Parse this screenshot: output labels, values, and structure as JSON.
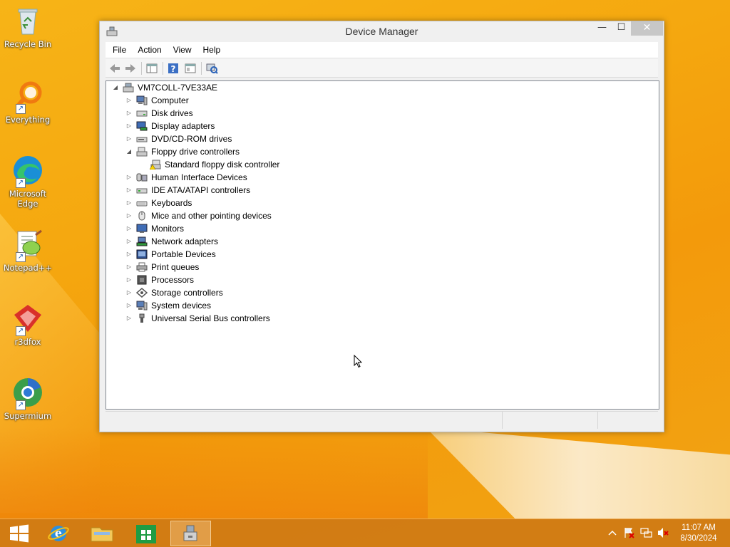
{
  "desktop": {
    "icons": [
      {
        "label": "Recycle Bin"
      },
      {
        "label": "Everything"
      },
      {
        "label": "Microsoft Edge"
      },
      {
        "label": "Notepad++"
      },
      {
        "label": "r3dfox"
      },
      {
        "label": "Supermium"
      }
    ]
  },
  "window": {
    "title": "Device Manager",
    "controls": {
      "minimize": "—",
      "maximize": "☐",
      "close": "✕"
    },
    "menu": [
      "File",
      "Action",
      "View",
      "Help"
    ]
  },
  "tree": {
    "root": "VM7COLL-7VE33AE",
    "categories": [
      {
        "label": "Computer",
        "icon": "computer-icon"
      },
      {
        "label": "Disk drives",
        "icon": "disk-drive-icon"
      },
      {
        "label": "Display adapters",
        "icon": "display-adapter-icon"
      },
      {
        "label": "DVD/CD-ROM drives",
        "icon": "dvd-drive-icon"
      },
      {
        "label": "Floppy drive controllers",
        "icon": "floppy-controller-icon",
        "expanded": true,
        "children": [
          {
            "label": "Standard floppy disk controller",
            "icon": "warning-device-icon"
          }
        ]
      },
      {
        "label": "Human Interface Devices",
        "icon": "hid-icon"
      },
      {
        "label": "IDE ATA/ATAPI controllers",
        "icon": "ide-controller-icon"
      },
      {
        "label": "Keyboards",
        "icon": "keyboard-icon"
      },
      {
        "label": "Mice and other pointing devices",
        "icon": "mouse-icon"
      },
      {
        "label": "Monitors",
        "icon": "monitor-icon"
      },
      {
        "label": "Network adapters",
        "icon": "network-adapter-icon"
      },
      {
        "label": "Portable Devices",
        "icon": "portable-device-icon"
      },
      {
        "label": "Print queues",
        "icon": "printer-icon"
      },
      {
        "label": "Processors",
        "icon": "processor-icon"
      },
      {
        "label": "Storage controllers",
        "icon": "storage-controller-icon"
      },
      {
        "label": "System devices",
        "icon": "system-device-icon"
      },
      {
        "label": "Universal Serial Bus controllers",
        "icon": "usb-icon"
      }
    ]
  },
  "taskbar": {
    "clock_time": "11:07 AM",
    "clock_date": "8/30/2024"
  },
  "colors": {
    "accent": "#f5a70f",
    "taskbar": "#cd7814",
    "close_button": "#c7c7c7"
  }
}
